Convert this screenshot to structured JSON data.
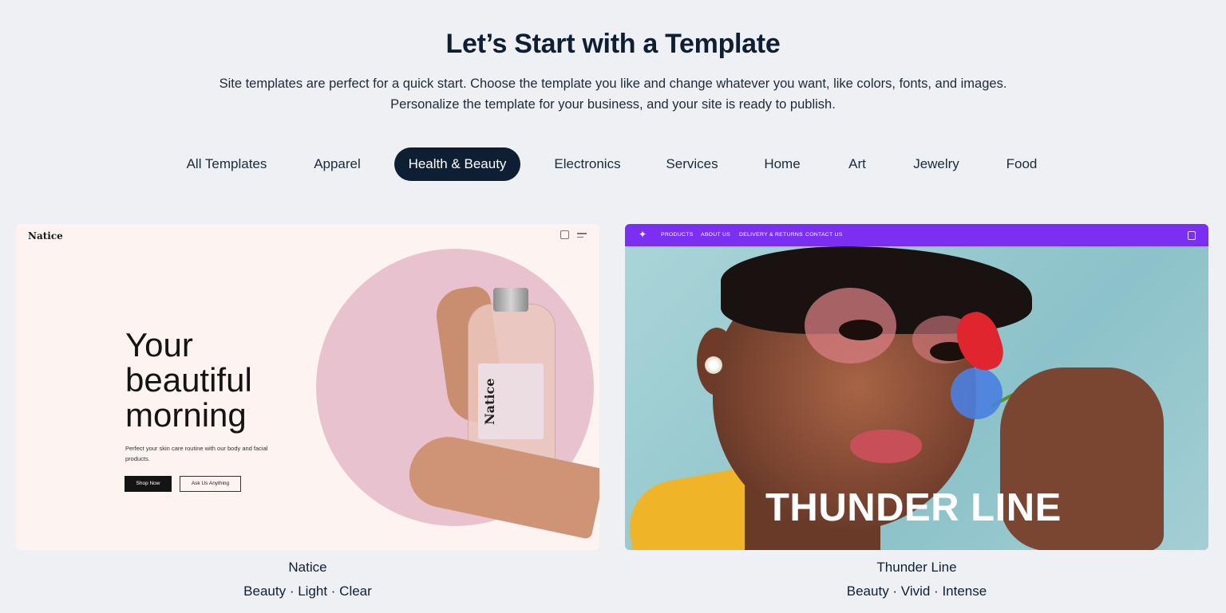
{
  "header": {
    "title": "Let’s Start with a Template",
    "subtitle_line1": "Site templates are perfect for a quick start. Choose the template you like and change whatever you want, like colors, fonts, and images.",
    "subtitle_line2": "Personalize the template for your business, and your site is ready to publish."
  },
  "tabs": [
    {
      "label": "All Templates",
      "active": false
    },
    {
      "label": "Apparel",
      "active": false
    },
    {
      "label": "Health & Beauty",
      "active": true
    },
    {
      "label": "Electronics",
      "active": false
    },
    {
      "label": "Services",
      "active": false
    },
    {
      "label": "Home",
      "active": false
    },
    {
      "label": "Art",
      "active": false
    },
    {
      "label": "Jewelry",
      "active": false
    },
    {
      "label": "Food",
      "active": false
    }
  ],
  "colors": {
    "background": "#eef0f4",
    "active_tab": "#0f1f33",
    "thunder_nav": "#7b2ff2"
  },
  "templates": [
    {
      "name": "Natice",
      "tags": "Beauty · Light · Clear",
      "preview": {
        "logo": "Natice",
        "icons": [
          "cart-icon",
          "menu-icon"
        ],
        "headline": [
          "Your",
          "beautiful",
          "morning"
        ],
        "body": "Perfect your skin care routine with our body and facial products.",
        "primary_button": "Shop Now",
        "secondary_button": "Ask Us Anything",
        "bottle_label": "Natice"
      }
    },
    {
      "name": "Thunder Line",
      "tags": "Beauty · Vivid · Intense",
      "preview": {
        "logo_icon": "unicorn-icon",
        "nav": [
          "PRODUCTS",
          "ABOUT US",
          "DELIVERY & RETURNS",
          "CONTACT US"
        ],
        "cart_icon": "cart-icon",
        "headline": "THUNDER LINE"
      }
    }
  ]
}
